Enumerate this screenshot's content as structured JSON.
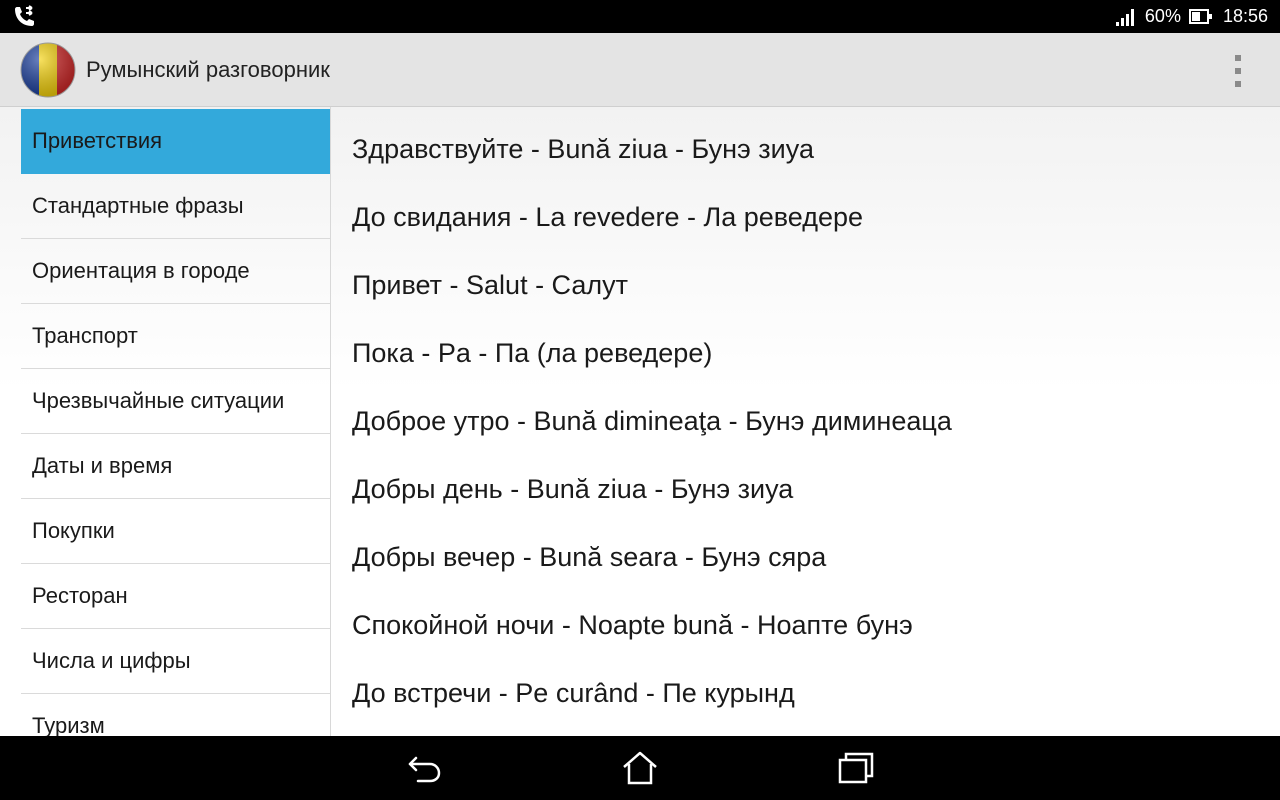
{
  "status_bar": {
    "battery_percent": "60%",
    "battery_level": 0.6,
    "time": "18:56",
    "icons": [
      "call-forward-icon",
      "signal-icon",
      "battery-icon"
    ]
  },
  "app": {
    "title": "Румынский разговорник",
    "logo_colors": [
      "#1b3f9e",
      "#f5d20c",
      "#d12b2b"
    ]
  },
  "sidebar": {
    "items": [
      {
        "label": "Приветствия",
        "selected": true
      },
      {
        "label": "Стандартные фразы"
      },
      {
        "label": "Ориентация в городе"
      },
      {
        "label": "Транспорт"
      },
      {
        "label": "Чрезвычайные ситуации"
      },
      {
        "label": "Даты и время"
      },
      {
        "label": "Покупки"
      },
      {
        "label": "Ресторан"
      },
      {
        "label": "Числа и цифры"
      },
      {
        "label": "Туризм"
      }
    ]
  },
  "phrases": [
    "Здравствуйте - Bună ziua - Бунэ зиуа",
    "До свидания - La revedere - Ла реведере",
    "Привет - Salut - Салут",
    "Пока - Pa - Па (ла реведере)",
    "Доброе утро - Bună dimineaţa - Бунэ диминеаца",
    "Добры день - Bună ziua - Бунэ зиуа",
    "Добры вечер - Bună seara - Бунэ сяра",
    "Спокойной ночи - Noapte bună - Ноапте бунэ",
    "До встречи - Pe curând - Пе курынд"
  ],
  "nav_bar": {
    "buttons": [
      "back-icon",
      "home-icon",
      "recents-icon"
    ]
  },
  "colors": {
    "accent": "#33a9db",
    "action_bar": "#e4e4e4"
  }
}
